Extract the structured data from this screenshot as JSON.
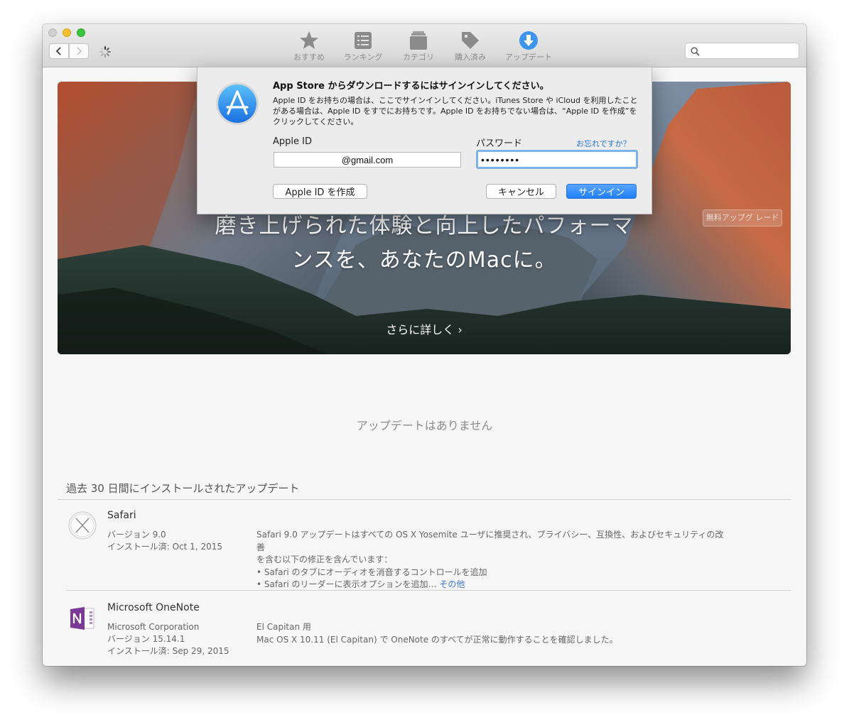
{
  "toolbar": {
    "items": [
      {
        "label": "おすすめ",
        "icon": "star-icon"
      },
      {
        "label": "ランキング",
        "icon": "list-icon"
      },
      {
        "label": "カテゴリ",
        "icon": "category-icon"
      },
      {
        "label": "購入済み",
        "icon": "tag-icon"
      },
      {
        "label": "アップデート",
        "icon": "download-icon"
      }
    ],
    "search_placeholder": ""
  },
  "hero": {
    "line1": "磨き上げられた体験と向上したパフォーマ",
    "line2": "ンスを、あなたのMacに。",
    "more": "さらに詳しく ›",
    "badge": "無料アップグ レード"
  },
  "dialog": {
    "title": "App Store からダウンロードするにはサインインしてください。",
    "body": "Apple ID をお持ちの場合は、ここでサインインしてください。iTunes Store や iCloud を利用したことがある場合は、Apple ID をすでにお持ちです。Apple ID をお持ちでない場合は、“Apple ID を作成”をクリックしてください。",
    "apple_id_label": "Apple ID",
    "apple_id_value": "@gmail.com",
    "password_label": "パスワード",
    "password_value": "••••••••",
    "forgot_label": "お忘れですか？",
    "create_label": "Apple ID を作成",
    "cancel_label": "キャンセル",
    "signin_label": "サインイン"
  },
  "updates": {
    "none_text": "アップデートはありません",
    "recent_title": "過去 30 日間にインストールされたアップデート",
    "apps": [
      {
        "name": "Safari",
        "meta": [
          "バージョン 9.0",
          "インストール済: Oct 1, 2015"
        ],
        "desc": [
          "Safari 9.0 アップデートはすべての OS X Yosemite ユーザに推奨され、プライバシー、互換性、およびセキュリティの改善",
          "を含む以下の修正を含んでいます：",
          "• Safari のタブにオーディオを消音するコントロールを追加",
          "• Safari のリーダーに表示オプションを追加…"
        ],
        "more": "その他"
      },
      {
        "name": "Microsoft OneNote",
        "meta": [
          "Microsoft Corporation",
          "バージョン 15.14.1",
          "インストール済: Sep 29, 2015"
        ],
        "desc": [
          "El Capitan 用",
          "Mac OS X 10.11 (El Capitan) で OneNote のすべてが正常に動作することを確認しました。"
        ]
      }
    ]
  },
  "colors": {
    "accent": "#1f7ef6",
    "link": "#2a73d0",
    "onenote": "#7b3a96"
  }
}
